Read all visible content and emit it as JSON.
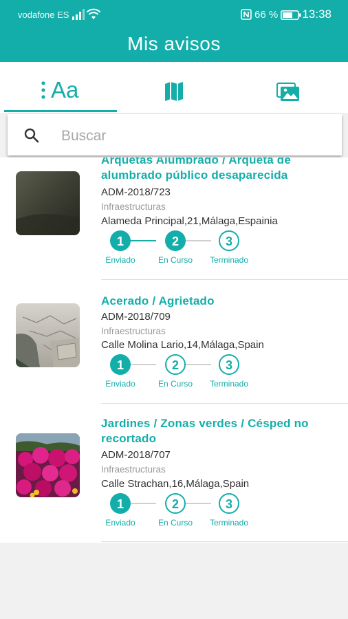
{
  "status_bar": {
    "carrier": "vodafone ES",
    "battery_percent": "66 %",
    "time": "13:38"
  },
  "app_bar": {
    "title": "Mis avisos"
  },
  "tabs": [
    {
      "label": "Aa",
      "icon": "text-list-icon",
      "selected": true
    },
    {
      "label": "",
      "icon": "map-icon",
      "selected": false
    },
    {
      "label": "",
      "icon": "gallery-icon",
      "selected": false
    }
  ],
  "search": {
    "placeholder": "Buscar",
    "value": ""
  },
  "items": [
    {
      "title": "Arquetas Alumbrado / Arqueta de alumbrado público desaparecida",
      "code": "ADM-2018/723",
      "category": "Infraestructuras",
      "address": "Alameda Principal,21,Málaga,Espainia",
      "steps_completed": 2
    },
    {
      "title": "Acerado / Agrietado",
      "code": "ADM-2018/709",
      "category": "Infraestructuras",
      "address": "Calle Molina Lario,14,Málaga,Spain",
      "steps_completed": 1
    },
    {
      "title": "Jardines / Zonas verdes / Césped no recortado",
      "code": "ADM-2018/707",
      "category": "Infraestructuras",
      "address": "Calle Strachan,16,Málaga,Spain",
      "steps_completed": 1
    }
  ],
  "stepper": {
    "steps": [
      {
        "number": "1",
        "label": "Enviado"
      },
      {
        "number": "2",
        "label": "En Curso"
      },
      {
        "number": "3",
        "label": "Terminado"
      }
    ]
  },
  "colors": {
    "accent": "#13aeaa",
    "text": "#333333",
    "muted": "#9a9a9a"
  }
}
